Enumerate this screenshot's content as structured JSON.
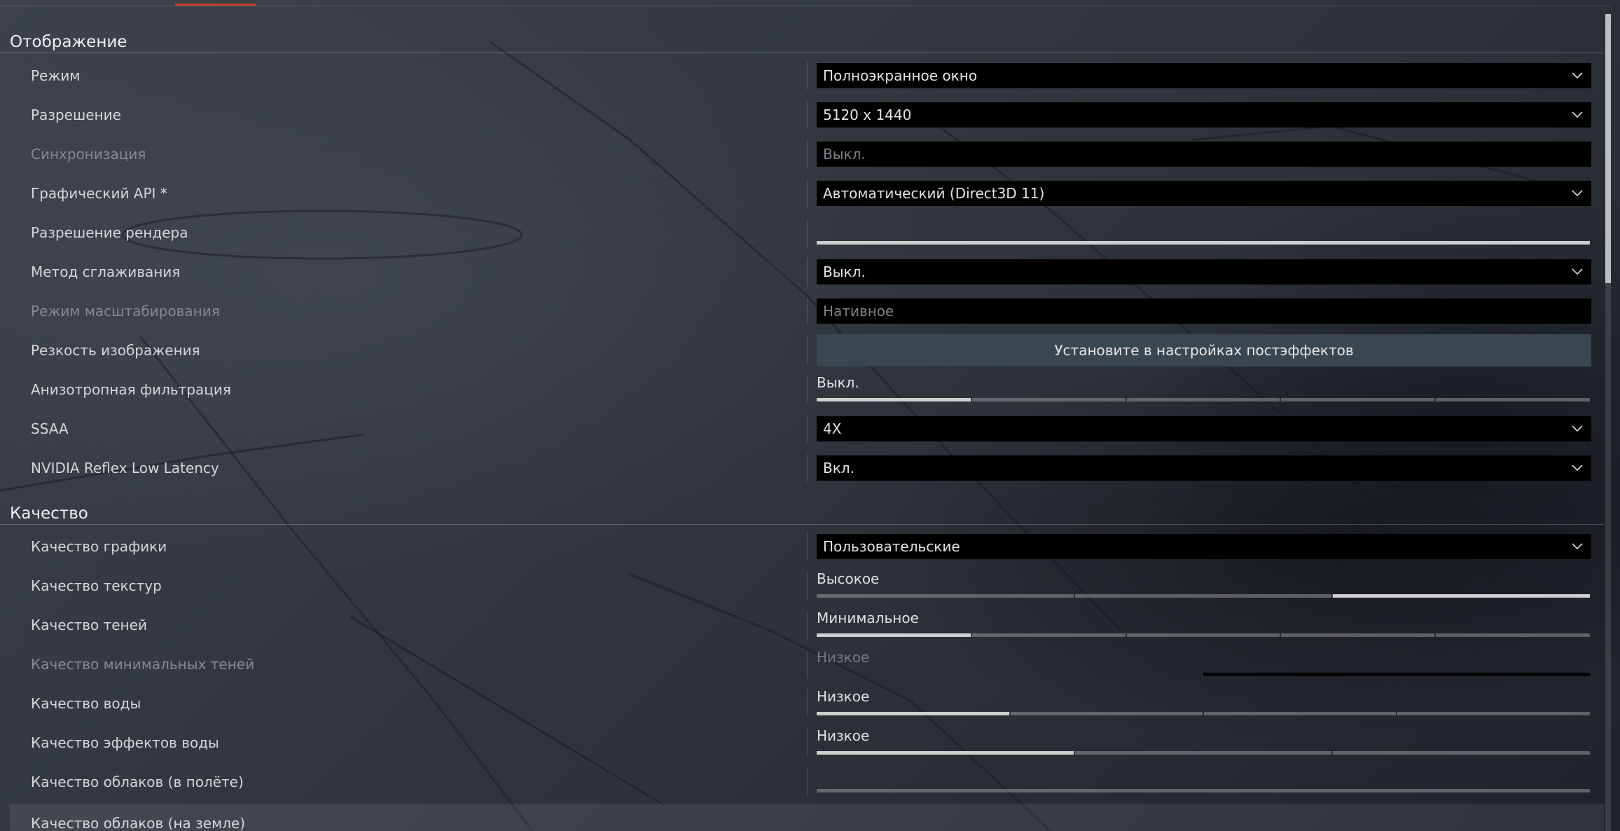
{
  "sections": {
    "display": {
      "title": "Отображение",
      "mode": {
        "label": "Режим",
        "value": "Полноэкранное окно"
      },
      "resolution": {
        "label": "Разрешение",
        "value": "5120 x 1440"
      },
      "vsync": {
        "label": "Синхронизация",
        "value": "Выкл."
      },
      "graphics_api": {
        "label": "Графический API *",
        "value": "Автоматический (Direct3D 11)"
      },
      "render_resolution": {
        "label": "Разрешение рендера",
        "level": 1.0
      },
      "antialiasing": {
        "label": "Метод сглаживания",
        "value": "Выкл."
      },
      "upscaling": {
        "label": "Режим масштабирования",
        "value": "Нативное"
      },
      "sharpness": {
        "label": "Резкость изображения",
        "button": "Установите в настройках постэффектов"
      },
      "anisotropic": {
        "label": "Анизотропная фильтрация",
        "value": "Выкл.",
        "level": 0.2,
        "steps": 5
      },
      "ssaa": {
        "label": "SSAA",
        "value": "4X"
      },
      "reflex": {
        "label": "NVIDIA Reflex Low Latency",
        "value": "Вкл."
      }
    },
    "quality": {
      "title": "Качество",
      "graphics_quality": {
        "label": "Качество графики",
        "value": "Пользовательские"
      },
      "texture_quality": {
        "label": "Качество текстур",
        "value": "Высокое",
        "level": 0.6667,
        "steps": 3
      },
      "shadow_quality": {
        "label": "Качество теней",
        "value": "Минимальное",
        "level": 0.2,
        "steps": 5
      },
      "min_shadow_quality": {
        "label": "Качество минимальных теней",
        "value": "Низкое"
      },
      "water_quality": {
        "label": "Качество воды",
        "value": "Низкое",
        "level": 0.25,
        "steps": 4
      },
      "water_effects_quality": {
        "label": "Качество эффектов воды",
        "value": "Низкое",
        "level": 0.3333,
        "steps": 3
      },
      "clouds_flight": {
        "label": "Качество облаков (в полёте)"
      },
      "clouds_ground": {
        "label": "Качество облаков (на земле)"
      }
    }
  },
  "colors": {
    "accent": "#c0392b",
    "dropdown_bg": "#000000",
    "button_bg": "#3a4650"
  },
  "icons": {
    "dropdown": "chevron-down-icon"
  }
}
